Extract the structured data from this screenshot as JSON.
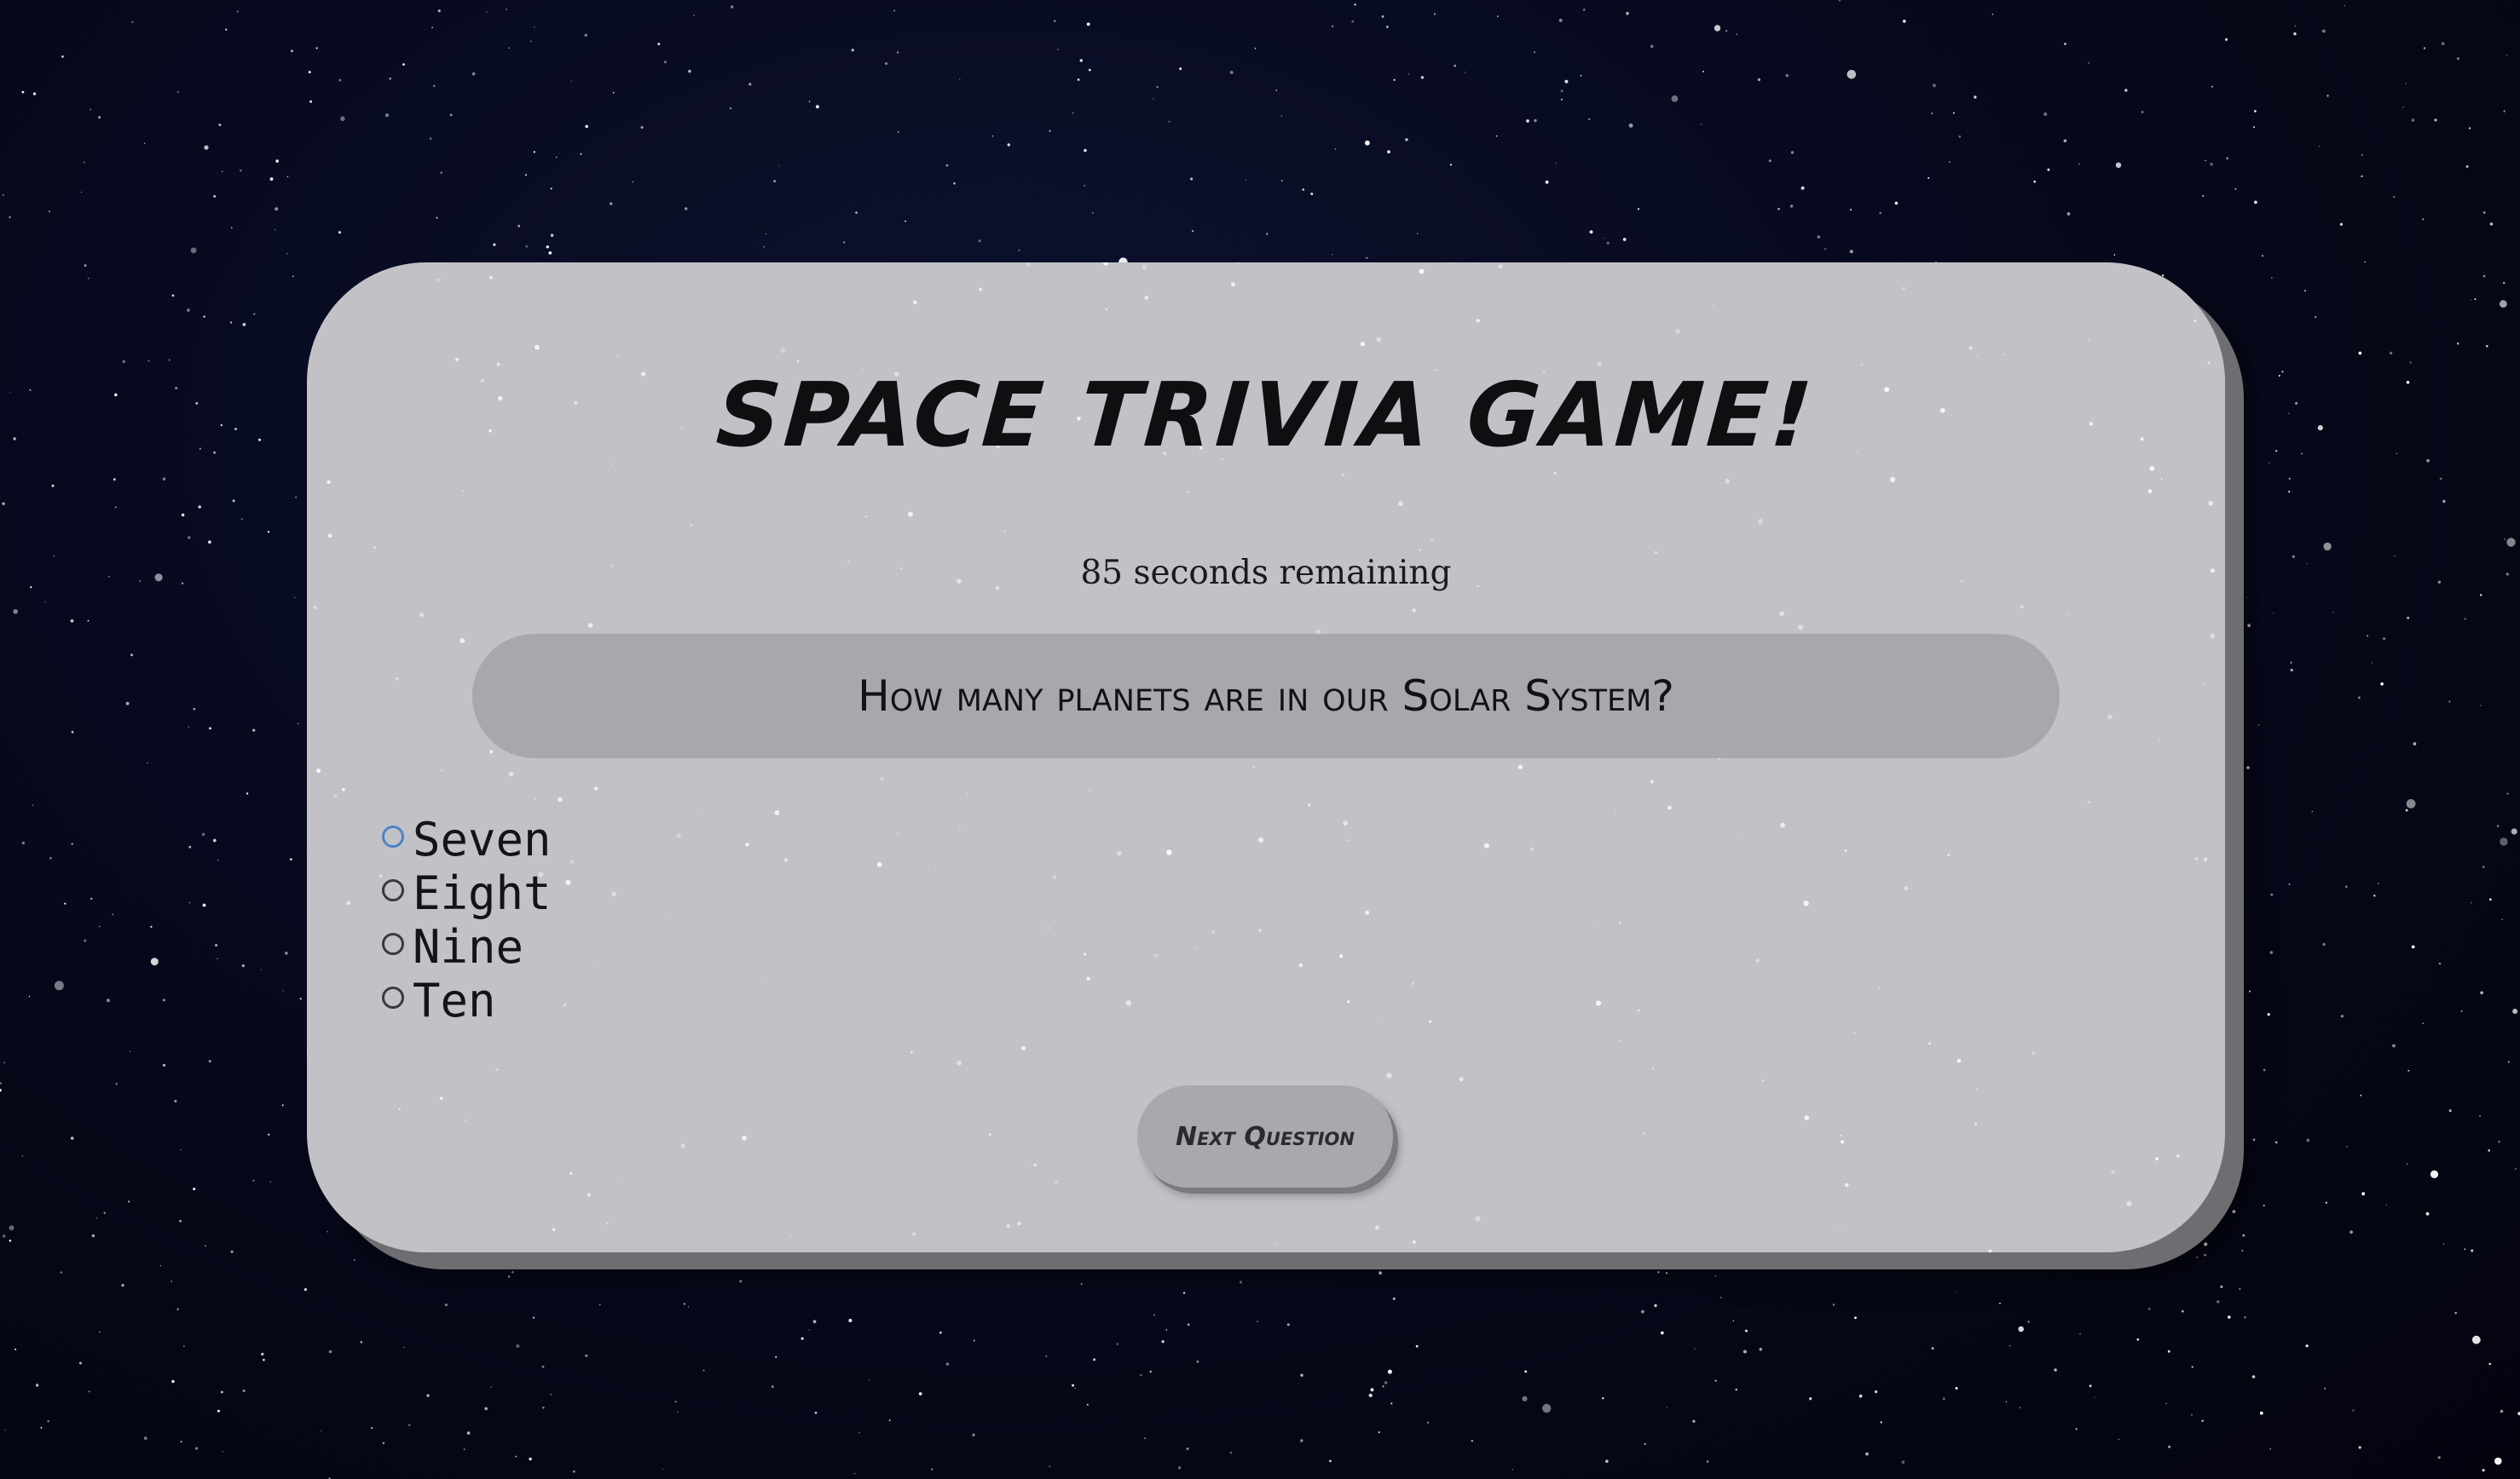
{
  "game": {
    "title": "Space Trivia Game!",
    "timer_text": "85 seconds remaining",
    "question": "How many planets are in our Solar System?",
    "options": [
      "Seven",
      "Eight",
      "Nine",
      "Ten"
    ],
    "selected_option": null,
    "focused_option": "Seven",
    "next_button_label": "Next Question"
  },
  "colors": {
    "background": "#070a1e",
    "card": "#c2c2c6",
    "question_box": "#a8a8ac",
    "button": "#a9a9ad",
    "focus_ring": "#4a84c8"
  }
}
